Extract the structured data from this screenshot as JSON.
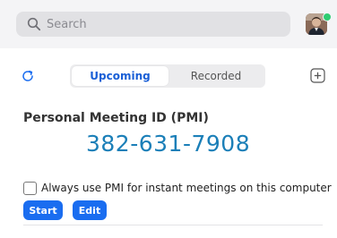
{
  "search": {
    "placeholder": "Search"
  },
  "user": {
    "avatar_icon": "avatar",
    "presence_color": "#2ecc71",
    "presence_status": "available"
  },
  "tabs": [
    {
      "label": "Upcoming",
      "active": true
    },
    {
      "label": "Recorded",
      "active": false
    }
  ],
  "toolbar": {
    "refresh_icon": "refresh-icon",
    "add_icon": "add-icon"
  },
  "pmi": {
    "title": "Personal Meeting ID (PMI)",
    "number": "382-631-7908",
    "option_label": "Always use PMI for instant meetings on this computer",
    "option_checked": false,
    "start_label": "Start",
    "edit_label": "Edit"
  },
  "colors": {
    "accent": "#1a6df0",
    "pmi_number": "#1b7fb8",
    "active_tab_text": "#1a5fd6"
  }
}
